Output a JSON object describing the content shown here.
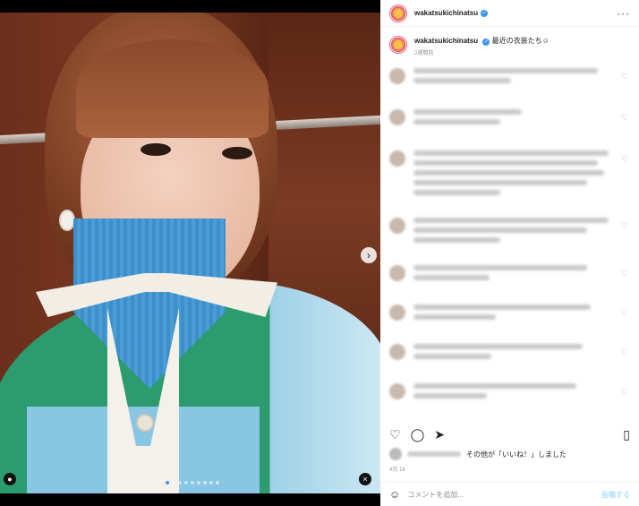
{
  "post": {
    "username": "wakatsukichinatsu",
    "caption": "最近の衣装たち☺︎",
    "posted": "2週間前"
  },
  "media": {
    "carousel_dots": 9,
    "active_dot": 0,
    "next_icon": "chevron-right-icon",
    "user_tag_icon": "person-icon",
    "audio_icon": "speaker-muted-icon"
  },
  "likes": {
    "text": "その他が「いいね！」しました"
  },
  "post_time": "4月 16",
  "comment_box": {
    "placeholder": "コメントを追加...",
    "post_label": "投稿する"
  },
  "colors": {
    "verified": "#3b95f0",
    "post_button": "#b2dffc"
  }
}
